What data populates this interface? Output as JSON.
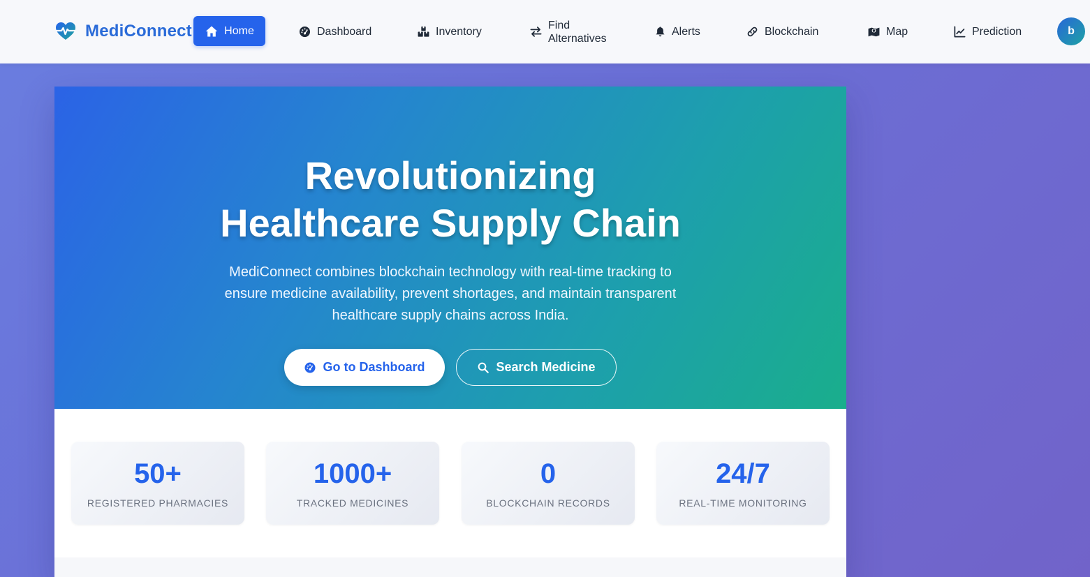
{
  "brand": {
    "name": "MediConnect",
    "icon": "heart-pulse-icon"
  },
  "nav": {
    "home": "Home",
    "dashboard": "Dashboard",
    "inventory": "Inventory",
    "find_line1": "Find",
    "find_line2": "Alternatives",
    "alerts": "Alerts",
    "blockchain": "Blockchain",
    "map": "Map",
    "prediction": "Prediction"
  },
  "user": {
    "avatar_initial": "b"
  },
  "hero": {
    "title_line1": "Revolutionizing",
    "title_line2": "Healthcare Supply Chain",
    "subtitle": "MediConnect combines blockchain technology with real-time tracking to ensure medicine availability, prevent shortages, and maintain transparent healthcare supply chains across India.",
    "primary_button": "Go to Dashboard",
    "secondary_button": "Search Medicine"
  },
  "stats": [
    {
      "value": "50+",
      "label": "REGISTERED PHARMACIES"
    },
    {
      "value": "1000+",
      "label": "TRACKED MEDICINES"
    },
    {
      "value": "0",
      "label": "BLOCKCHAIN RECORDS"
    },
    {
      "value": "24/7",
      "label": "REAL-TIME MONITORING"
    }
  ],
  "colors": {
    "accent": "#2563eb",
    "brand_text": "#2a6bd8",
    "hero_gradient_start": "#2b63e6",
    "hero_gradient_end": "#1aae8c",
    "page_background": "#6b6fd6"
  }
}
